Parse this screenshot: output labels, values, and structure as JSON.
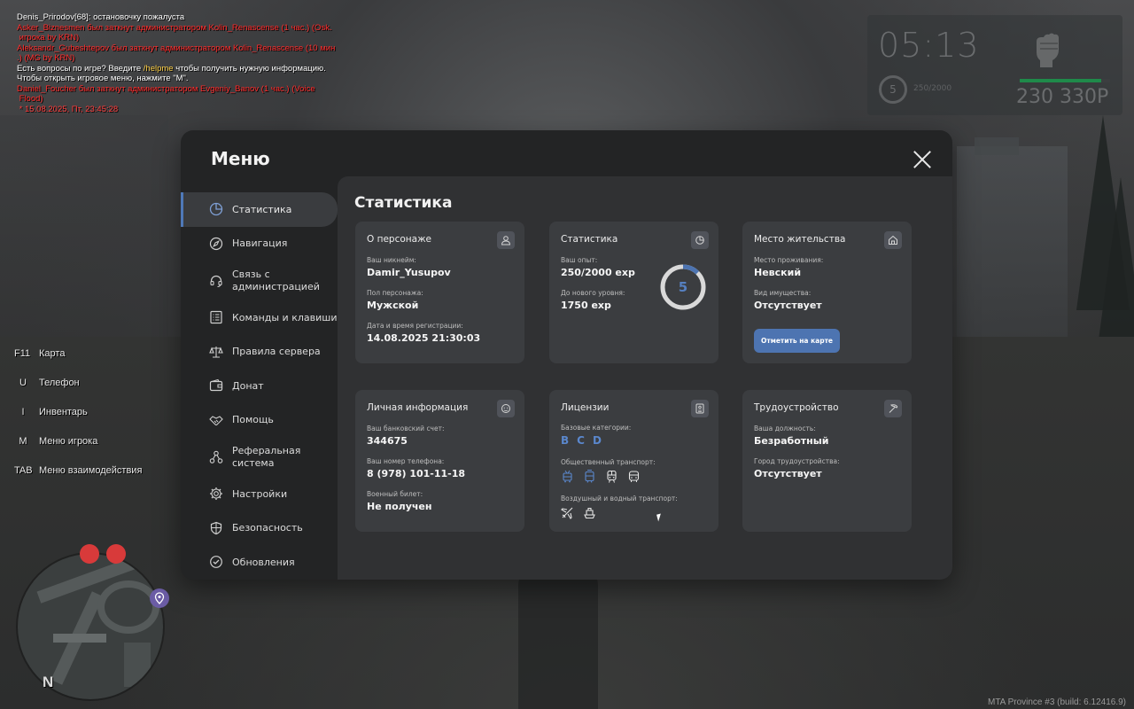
{
  "chat": [
    {
      "text": "Denis_Prirodov[68]: остановочку пожалуста",
      "color": "white"
    },
    {
      "text": "Asker_Biznesmen был заткнут администратором Kolin_Renascense (1 час.) (Osk.\n игрока by KRN)",
      "color": "red"
    },
    {
      "text": "Aleksandr_Gubeshtepov был заткнут администратором Kolin_Renascense (10 мин\n.) (MG by KRN)",
      "color": "red"
    },
    {
      "text": "Есть вопросы по игре? Введите /helpme чтобы получить нужную информацию.",
      "color": "white"
    },
    {
      "text": "Чтобы открыть игровое меню, нажмите \"M\".",
      "color": "white"
    },
    {
      "text": "Daniel_Foucher был заткнут администратором Evgeniy_Banov (1 час.) (Voice\n Flood)",
      "color": "red"
    },
    {
      "text": " * 15.08.2025, Пт, 23:45:28",
      "color": "lred"
    }
  ],
  "hud": {
    "time": "05:13",
    "level": "5",
    "exp": "250/2000",
    "money": "230 330Р",
    "health_fraction": 0.9
  },
  "hotkeys": [
    {
      "key": "F11",
      "label": "Карта"
    },
    {
      "key": "U",
      "label": "Телефон"
    },
    {
      "key": "I",
      "label": "Инвентарь"
    },
    {
      "key": "M",
      "label": "Меню игрока"
    },
    {
      "key": "TAB",
      "label": "Меню взаимодействия"
    }
  ],
  "minimap": {
    "north": "N"
  },
  "build_info": "MTA Province #3 (build: 6.12416.9)",
  "menu": {
    "title": "Меню",
    "nav": [
      {
        "label": "Статистика",
        "icon": "pie-chart-icon",
        "active": true
      },
      {
        "label": "Навигация",
        "icon": "compass-icon"
      },
      {
        "label": "Связь с\nадминистрацией",
        "icon": "headset-icon"
      },
      {
        "label": "Команды и клавиши",
        "icon": "keyboard-list-icon"
      },
      {
        "label": "Правила сервера",
        "icon": "scales-icon"
      },
      {
        "label": "Донат",
        "icon": "wallet-icon"
      },
      {
        "label": "Помощь",
        "icon": "handshake-icon"
      },
      {
        "label": "Реферальная\nсистема",
        "icon": "referral-network-icon"
      },
      {
        "label": "Настройки",
        "icon": "gear-icon"
      },
      {
        "label": "Безопасность",
        "icon": "shield-icon"
      },
      {
        "label": "Обновления",
        "icon": "check-circle-icon"
      }
    ],
    "content_title": "Статистика",
    "cards": {
      "character": {
        "title": "О персонаже",
        "nick_label": "Ваш никнейм:",
        "nick": "Damir_Yusupov",
        "gender_label": "Пол персонажа:",
        "gender": "Мужской",
        "reg_label": "Дата и время регистрации:",
        "reg": "14.08.2025 21:30:03"
      },
      "stats": {
        "title": "Статистика",
        "exp_label": "Ваш опыт:",
        "exp": "250/2000 exp",
        "next_label": "До нового уровня:",
        "next": "1750 exp",
        "level": "5",
        "progress": 0.125
      },
      "residence": {
        "title": "Место жительства",
        "place_label": "Место проживания:",
        "place": "Невский",
        "property_label": "Вид имущества:",
        "property": "Отсутствует",
        "button": "Отметить на карте"
      },
      "personal": {
        "title": "Личная информация",
        "bank_label": "Ваш банковский счет:",
        "bank": "344675",
        "phone_label": "Ваш номер телефона:",
        "phone": "8 (978) 101-11-18",
        "military_label": "Военный билет:",
        "military": "Не получен"
      },
      "licenses": {
        "title": "Лицензии",
        "base_label": "Базовые категории:",
        "base": [
          "B",
          "C",
          "D"
        ],
        "public_label": "Общественный транспорт:",
        "air_label": "Воздушный и водный транспорт:"
      },
      "employment": {
        "title": "Трудоустройство",
        "position_label": "Ваша должность:",
        "position": "Безработный",
        "city_label": "Город трудоустройства:",
        "city": "Отсутствует"
      }
    }
  },
  "colors": {
    "accent": "#4d74b1",
    "card": "#3b3d40",
    "panel": "#303133"
  }
}
